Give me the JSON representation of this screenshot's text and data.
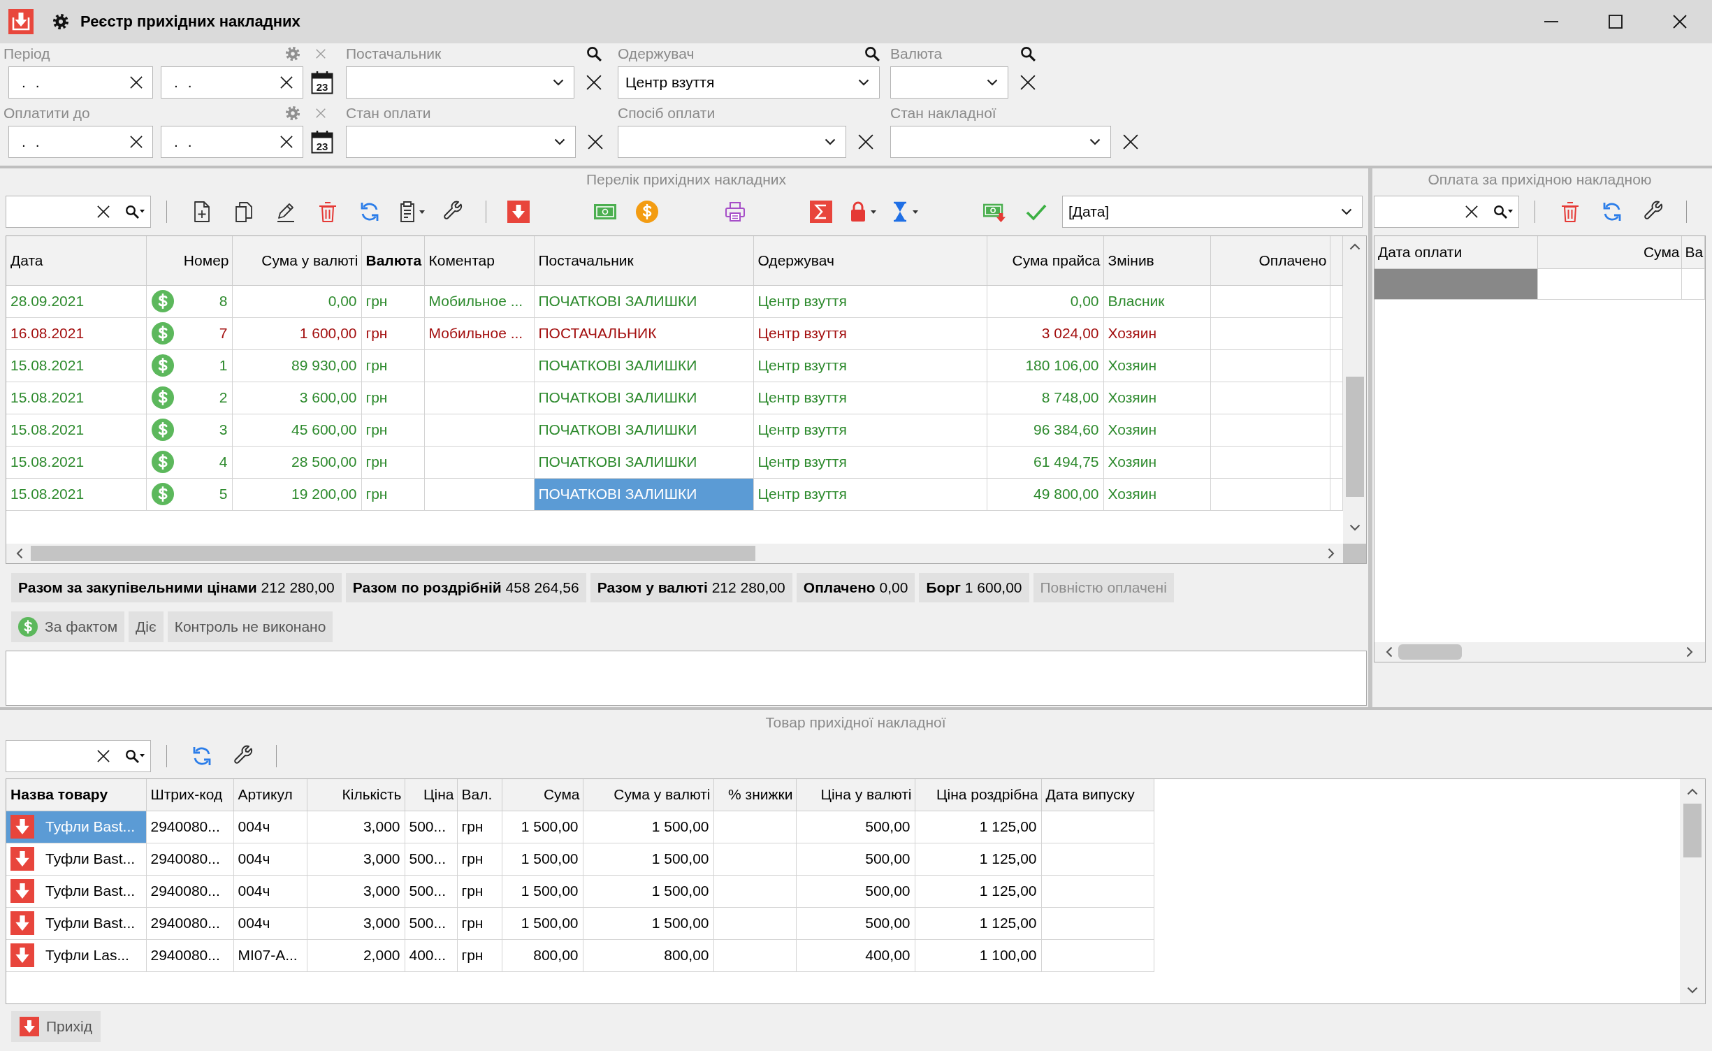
{
  "window": {
    "title": "Реєстр прихідних накладних"
  },
  "filters": [
    [
      {
        "kind": "date_range",
        "label": "Період",
        "from": ". .",
        "to": ". .",
        "calendar_day": "23"
      },
      {
        "kind": "combo",
        "label": "Постачальник",
        "search": true,
        "clear": true
      },
      {
        "kind": "combo",
        "label": "Одержувач",
        "value": "Центр взуття",
        "search": true,
        "clear": false
      },
      {
        "kind": "combo",
        "label": "Валюта",
        "search": true,
        "clear": true
      }
    ],
    [
      {
        "kind": "date_range",
        "label": "Оплатити до",
        "from": ". .",
        "to": ". .",
        "calendar_day": "23"
      },
      {
        "kind": "combo",
        "label": "Стан оплати",
        "search": false,
        "clear": true
      },
      {
        "kind": "combo",
        "label": "Спосіб оплати",
        "search": false,
        "clear": true
      },
      {
        "kind": "combo",
        "label": "Стан накладної",
        "search": false,
        "clear": true
      }
    ]
  ],
  "invoices": {
    "title": "Перелік прихідних накладних",
    "sort_by": "[Дата]",
    "columns": [
      {
        "label": "Дата",
        "active": false,
        "focused": false
      },
      {
        "label": "Номер",
        "active": false,
        "focused": false
      },
      {
        "label": "Сума у валюті",
        "active": false,
        "focused": false
      },
      {
        "label": "Валюта",
        "active": true,
        "focused": false
      },
      {
        "label": "Коментар",
        "active": false,
        "focused": false
      },
      {
        "label": "Постачальник",
        "active": false,
        "focused": true
      },
      {
        "label": "Одержувач",
        "active": false,
        "focused": false
      },
      {
        "label": "Сума прайса",
        "active": false,
        "focused": false
      },
      {
        "label": "Змінив",
        "active": false,
        "focused": false
      },
      {
        "label": "Оплачено",
        "active": false,
        "focused": false
      }
    ],
    "rows": [
      {
        "date": "28.09.2021",
        "number": "8",
        "sum_currency": "0,00",
        "currency": "грн",
        "comment": "Мобильное ...",
        "supplier": "ПОЧАТКОВІ ЗАЛИШКИ",
        "recipient": "Центр взуття",
        "price_sum": "0,00",
        "changed_by": "Власник",
        "debt": false,
        "selected": false
      },
      {
        "date": "16.08.2021",
        "number": "7",
        "sum_currency": "1 600,00",
        "currency": "грн",
        "comment": "Мобильное ...",
        "supplier": "ПОСТАЧАЛЬНИК",
        "recipient": "Центр взуття",
        "price_sum": "3 024,00",
        "changed_by": "Хозяин",
        "debt": true,
        "selected": false
      },
      {
        "date": "15.08.2021",
        "number": "1",
        "sum_currency": "89 930,00",
        "currency": "грн",
        "supplier": "ПОЧАТКОВІ ЗАЛИШКИ",
        "recipient": "Центр взуття",
        "price_sum": "180 106,00",
        "changed_by": "Хозяин",
        "debt": false,
        "selected": false
      },
      {
        "date": "15.08.2021",
        "number": "2",
        "sum_currency": "3 600,00",
        "currency": "грн",
        "supplier": "ПОЧАТКОВІ ЗАЛИШКИ",
        "recipient": "Центр взуття",
        "price_sum": "8 748,00",
        "changed_by": "Хозяин",
        "debt": false,
        "selected": false
      },
      {
        "date": "15.08.2021",
        "number": "3",
        "sum_currency": "45 600,00",
        "currency": "грн",
        "supplier": "ПОЧАТКОВІ ЗАЛИШКИ",
        "recipient": "Центр взуття",
        "price_sum": "96 384,60",
        "changed_by": "Хозяин",
        "debt": false,
        "selected": false
      },
      {
        "date": "15.08.2021",
        "number": "4",
        "sum_currency": "28 500,00",
        "currency": "грн",
        "supplier": "ПОЧАТКОВІ ЗАЛИШКИ",
        "recipient": "Центр взуття",
        "price_sum": "61 494,75",
        "changed_by": "Хозяин",
        "debt": false,
        "selected": false
      },
      {
        "date": "15.08.2021",
        "number": "5",
        "sum_currency": "19 200,00",
        "currency": "грн",
        "supplier": "ПОЧАТКОВІ ЗАЛИШКИ",
        "recipient": "Центр взуття",
        "price_sum": "49 800,00",
        "changed_by": "Хозяин",
        "debt": false,
        "selected": true
      }
    ],
    "totals": [
      {
        "kind": "total",
        "label": "Разом за закупівельними цінами",
        "value": "212 280,00"
      },
      {
        "kind": "total",
        "label": "Разом по роздрібній",
        "value": "458 264,56"
      },
      {
        "kind": "total",
        "label": "Разом у валюті",
        "value": "212 280,00"
      },
      {
        "kind": "total",
        "label": "Оплачено",
        "value": "0,00"
      },
      {
        "kind": "total",
        "label": "Борг",
        "value": "1 600,00"
      },
      {
        "kind": "toggle",
        "label": "Повністю оплачені",
        "disabled": true
      }
    ],
    "chips": [
      {
        "kind": "payment",
        "label": "За фактом"
      },
      {
        "kind": "plain",
        "label": "Діє"
      },
      {
        "kind": "plain",
        "label": "Контроль не виконано"
      }
    ]
  },
  "payments": {
    "title": "Оплата за прихідною накладною",
    "columns": [
      {
        "label": "Дата оплати"
      },
      {
        "label": "Сума"
      },
      {
        "label": "Ва"
      }
    ],
    "rows": [
      {
        "selected": true
      }
    ]
  },
  "goods": {
    "title": "Товар прихідної накладної",
    "columns": [
      {
        "label": "Назва товару",
        "active": true,
        "focused": true
      },
      {
        "label": "Штрих-код",
        "active": false,
        "focused": false
      },
      {
        "label": "Артикул",
        "active": false,
        "focused": false
      },
      {
        "label": "Кількість",
        "active": false,
        "focused": false
      },
      {
        "label": "Ціна",
        "active": false,
        "focused": false
      },
      {
        "label": "Вал.",
        "active": false,
        "focused": false
      },
      {
        "label": "Сума",
        "active": false,
        "focused": false
      },
      {
        "label": "Сума у валюті",
        "active": false,
        "focused": false
      },
      {
        "label": "% знижки",
        "active": false,
        "focused": false
      },
      {
        "label": "Ціна у валюті",
        "active": false,
        "focused": false
      },
      {
        "label": "Ціна роздрібна",
        "active": false,
        "focused": false
      },
      {
        "label": "Дата випуску",
        "active": false,
        "focused": false
      }
    ],
    "rows": [
      {
        "name": "Туфли Bast...",
        "barcode": "2940080...",
        "article": "004ч",
        "quantity": "3,000",
        "price": "500...",
        "currency": "грн",
        "sum": "1 500,00",
        "sum_currency": "1 500,00",
        "price_currency": "500,00",
        "price_retail": "1 125,00",
        "selected": true
      },
      {
        "name": "Туфли Bast...",
        "barcode": "2940080...",
        "article": "004ч",
        "quantity": "3,000",
        "price": "500...",
        "currency": "грн",
        "sum": "1 500,00",
        "sum_currency": "1 500,00",
        "price_currency": "500,00",
        "price_retail": "1 125,00",
        "selected": false
      },
      {
        "name": "Туфли Bast...",
        "barcode": "2940080...",
        "article": "004ч",
        "quantity": "3,000",
        "price": "500...",
        "currency": "грн",
        "sum": "1 500,00",
        "sum_currency": "1 500,00",
        "price_currency": "500,00",
        "price_retail": "1 125,00",
        "selected": false
      },
      {
        "name": "Туфли Bast...",
        "barcode": "2940080...",
        "article": "004ч",
        "quantity": "3,000",
        "price": "500...",
        "currency": "грн",
        "sum": "1 500,00",
        "sum_currency": "1 500,00",
        "price_currency": "500,00",
        "price_retail": "1 125,00",
        "selected": false
      },
      {
        "name": "Туфли Las...",
        "barcode": "2940080...",
        "article": "MI07-A...",
        "quantity": "2,000",
        "price": "400...",
        "currency": "грн",
        "sum": "800,00",
        "sum_currency": "800,00",
        "price_currency": "400,00",
        "price_retail": "1 100,00",
        "selected": false
      }
    ]
  },
  "footer_button": {
    "label": "Прихід"
  }
}
